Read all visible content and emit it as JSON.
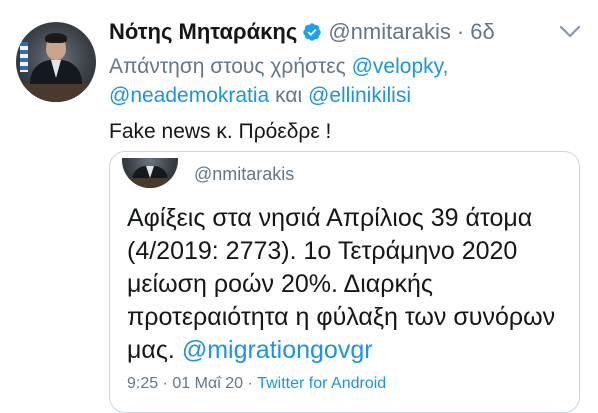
{
  "author": {
    "name": "Νότης Μηταράκης",
    "handle": "@nmitarakis",
    "time": "6δ",
    "separator": "·"
  },
  "reply": {
    "prefix": "Απάντηση στους χρήστες",
    "mention1": "@velopky",
    "comma": ",",
    "mention2": "@neademokratia",
    "conjunction": "και",
    "mention3": "@ellinikilisi"
  },
  "tweet_text": "Fake news κ. Πρόεδρε !",
  "quoted": {
    "handle": "@nmitarakis",
    "text_before": "Αφίξεις στα νησιά Απρίλιος 39 άτομα (4/2019: 2773). 1ο Τετράμηνο 2020 μείωση  ροών 20%. Διαρκής προτεραιότητα η φύλαξη των συνόρων μας.",
    "text_mention": "@migrationgovgr",
    "time": "9:25",
    "separator": "·",
    "date": "01 Μαΐ 20",
    "source": "Twitter for Android"
  },
  "icons": {
    "verified": "verified-badge-icon",
    "menu": "chevron-down-icon"
  },
  "colors": {
    "link": "#1b95e0",
    "secondary_text": "#657786",
    "verified": "#1da1f2",
    "border": "#ccd6dd"
  }
}
